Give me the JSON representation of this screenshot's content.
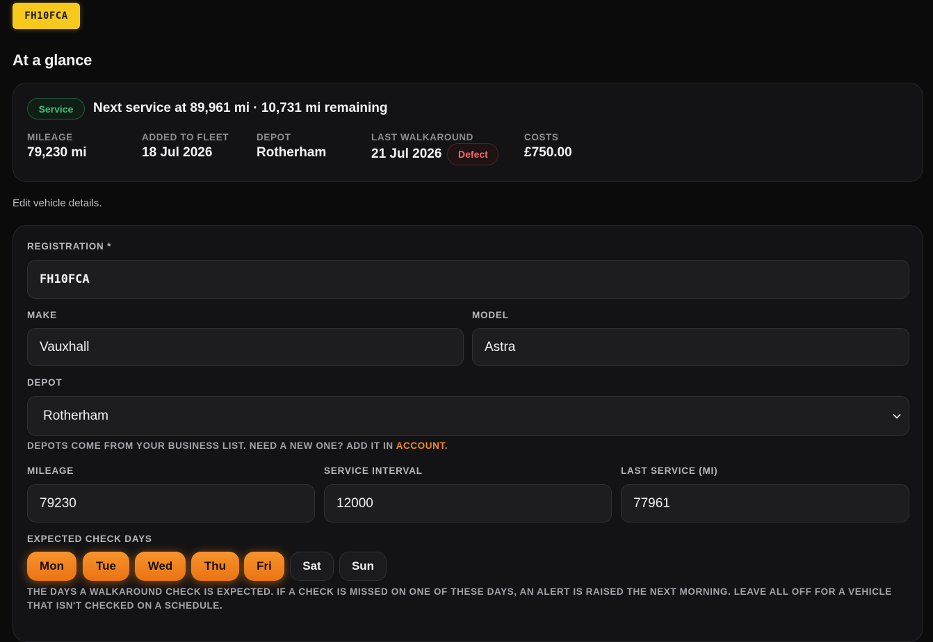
{
  "plate": "FH10FCA",
  "glance": {
    "title": "At a glance",
    "service_badge": "Service",
    "service_text": "Next service at 89,961 mi · 10,731 mi remaining",
    "stats": [
      {
        "label": "MILEAGE",
        "value": "79,230 mi"
      },
      {
        "label": "ADDED TO FLEET",
        "value": "18 Jul 2026"
      },
      {
        "label": "DEPOT",
        "value": "Rotherham"
      },
      {
        "label": "LAST WALKAROUND",
        "value": "21 Jul 2026",
        "badge": "Defect"
      },
      {
        "label": "COSTS",
        "value": "£750.00"
      }
    ]
  },
  "edit_note": "Edit vehicle details.",
  "form": {
    "registration": {
      "label": "REGISTRATION *",
      "value": "FH10FCA"
    },
    "make": {
      "label": "MAKE",
      "value": "Vauxhall"
    },
    "model": {
      "label": "MODEL",
      "value": "Astra"
    },
    "depot": {
      "label": "DEPOT",
      "value": "Rotherham",
      "hint_prefix": "DEPOTS COME FROM YOUR BUSINESS LIST. NEED A NEW ONE? ADD IT IN",
      "hint_link": "ACCOUNT",
      "hint_suffix": "."
    },
    "mileage": {
      "label": "MILEAGE",
      "value": "79230"
    },
    "service_interval": {
      "label": "SERVICE INTERVAL",
      "value": "12000"
    },
    "last_service": {
      "label": "LAST SERVICE (MI)",
      "value": "77961"
    },
    "check_days": {
      "label": "EXPECTED CHECK DAYS",
      "days": [
        {
          "label": "Mon",
          "on": true
        },
        {
          "label": "Tue",
          "on": true
        },
        {
          "label": "Wed",
          "on": true
        },
        {
          "label": "Thu",
          "on": true
        },
        {
          "label": "Fri",
          "on": true
        },
        {
          "label": "Sat",
          "on": false
        },
        {
          "label": "Sun",
          "on": false
        }
      ],
      "hint": "THE DAYS A WALKAROUND CHECK IS EXPECTED. IF A CHECK IS MISSED ON ONE OF THESE DAYS, AN ALERT IS RAISED THE NEXT MORNING. LEAVE ALL OFF FOR A VEHICLE THAT ISN'T CHECKED ON A SCHEDULE."
    }
  },
  "colors": {
    "accent": "#f28a22",
    "plate": "#f7c91d",
    "service_green": "#3ec27a",
    "defect_red": "#f06a6a"
  },
  "icons": {
    "select": "chevron-down-icon"
  }
}
